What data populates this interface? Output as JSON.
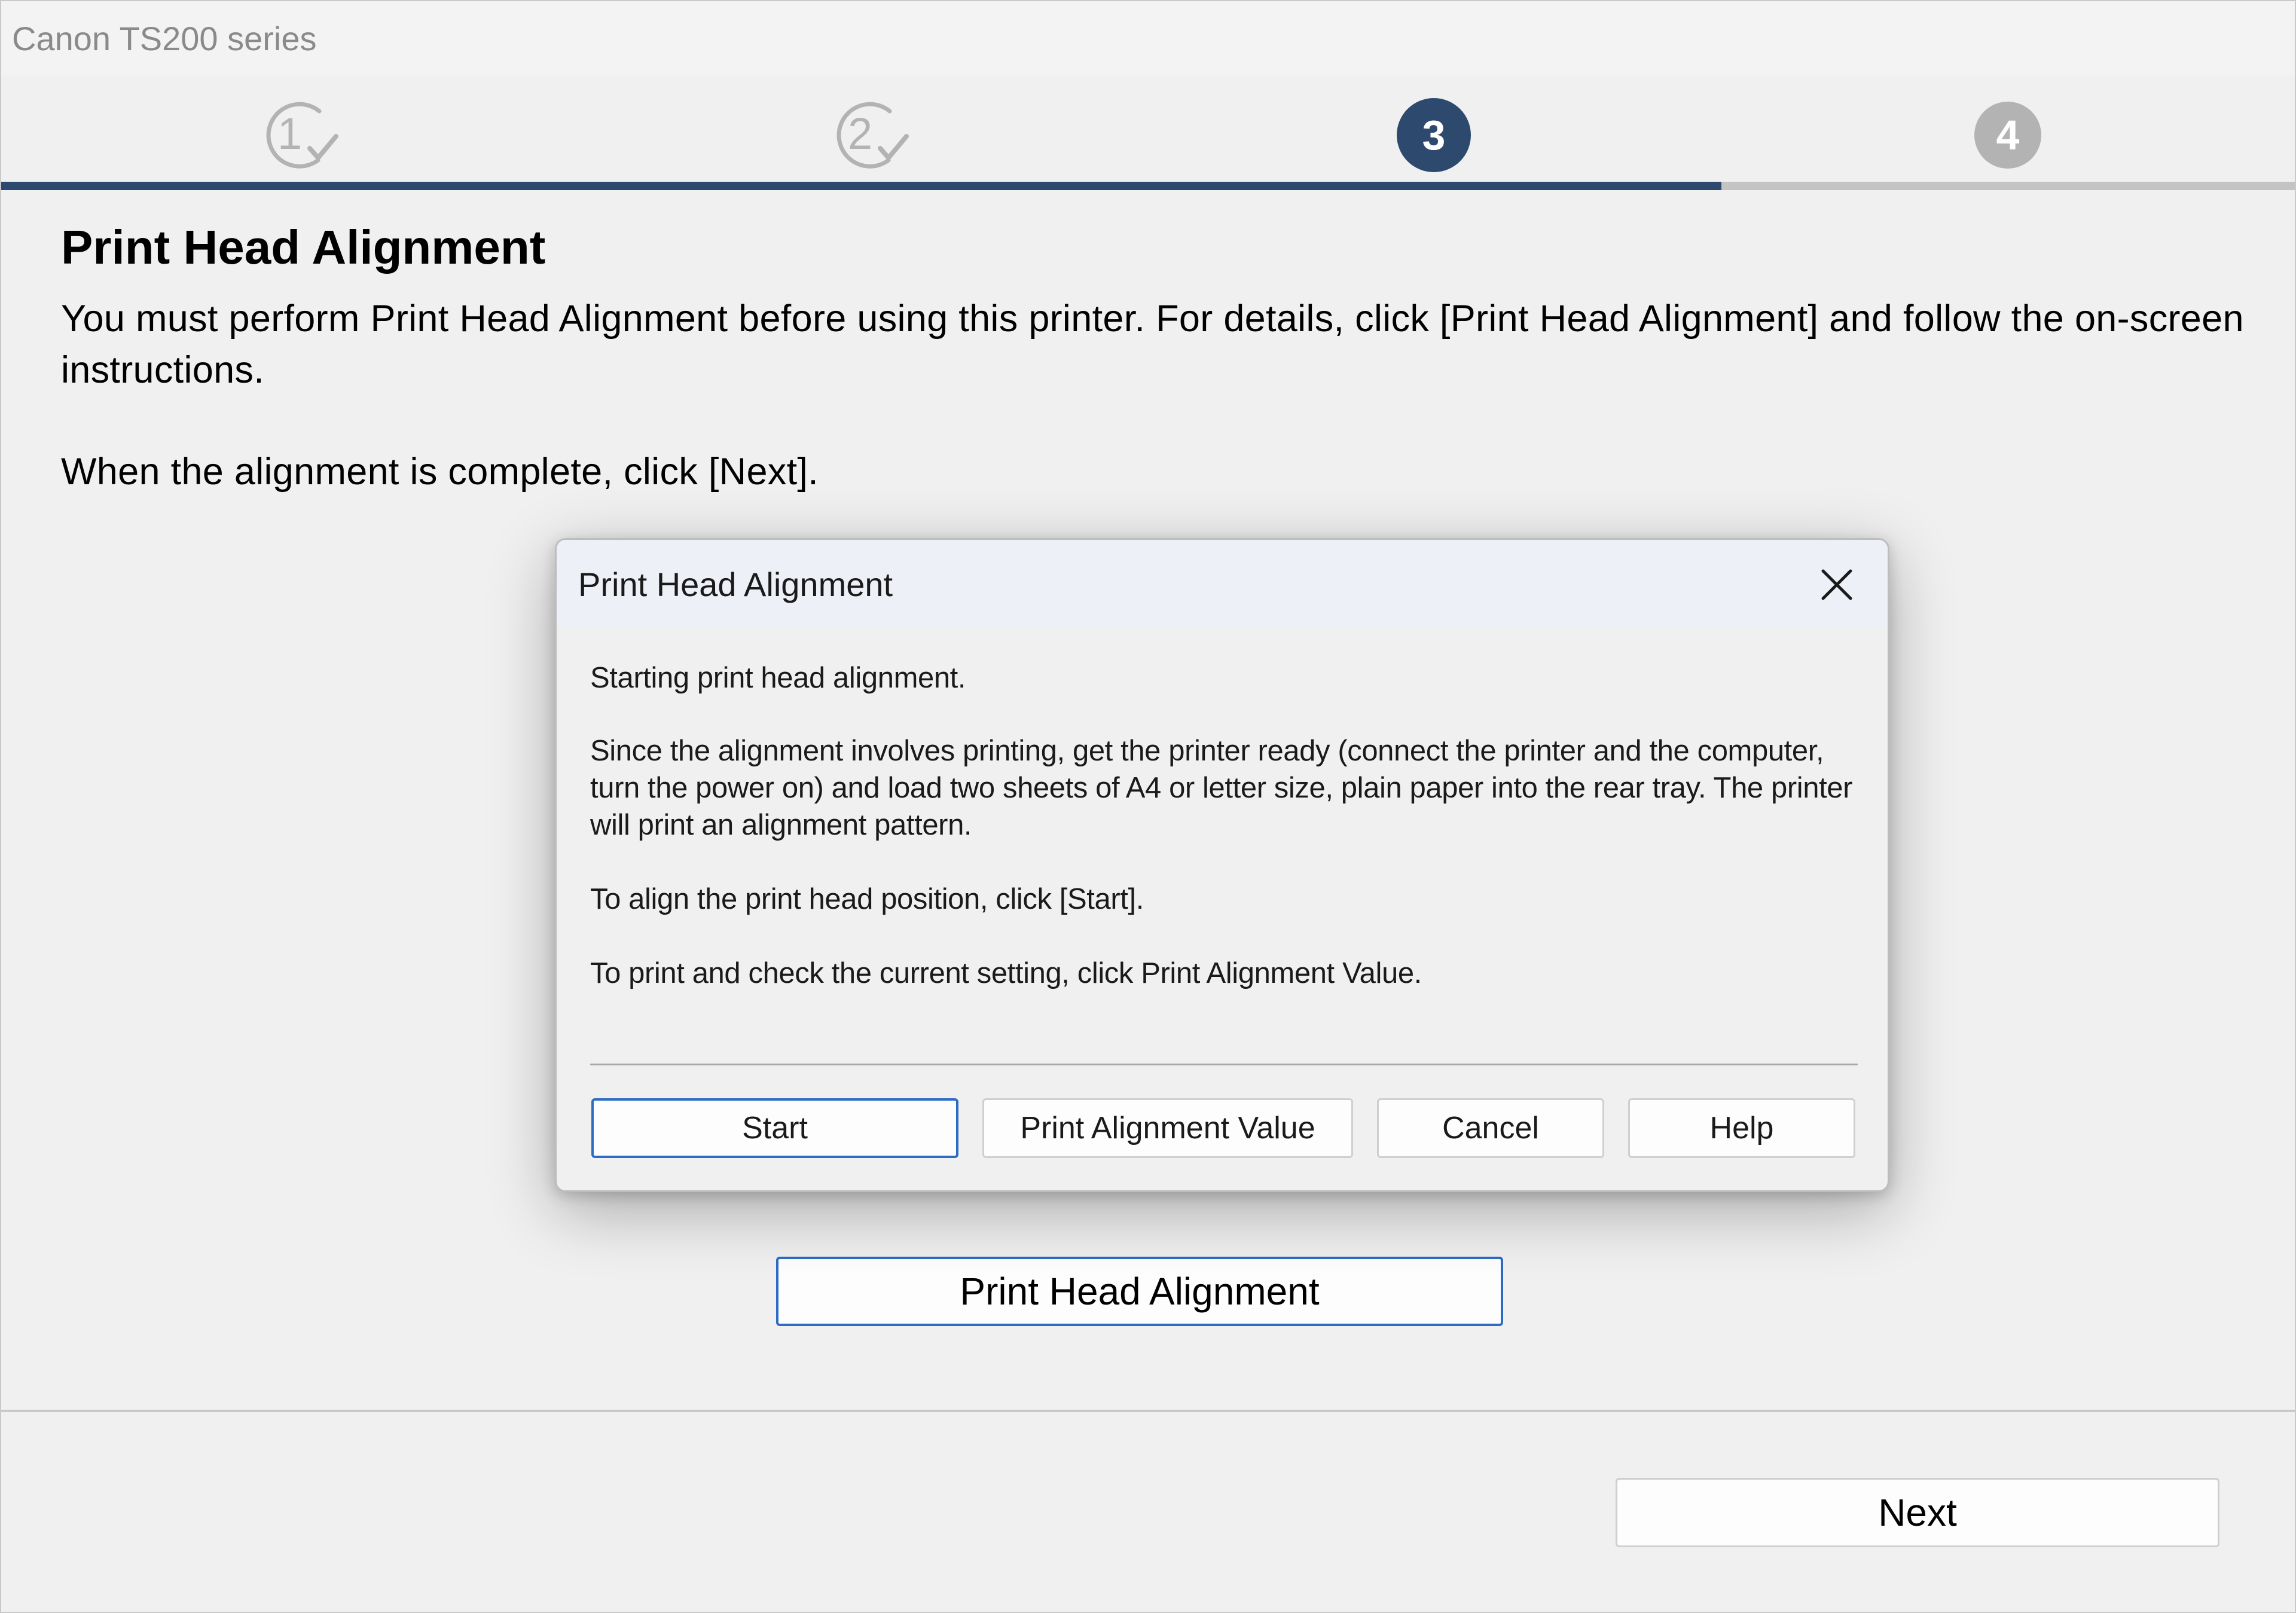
{
  "window": {
    "title": "Canon TS200 series"
  },
  "steps": [
    {
      "number": "1",
      "state": "completed"
    },
    {
      "number": "2",
      "state": "completed"
    },
    {
      "number": "3",
      "state": "current"
    },
    {
      "number": "4",
      "state": "upcoming"
    }
  ],
  "progress": {
    "completed_fraction": 0.75,
    "fill_color": "#2d4a6e",
    "track_color": "#c4c4c4"
  },
  "main": {
    "heading": "Print Head Alignment",
    "paragraph1": "You must perform Print Head Alignment before using this printer. For details, click [Print Head Alignment] and follow the on-screen instructions.",
    "paragraph2": "When the alignment is complete, click [Next].",
    "alignment_button_label": "Print Head Alignment"
  },
  "footer": {
    "next_label": "Next"
  },
  "dialog": {
    "title": "Print Head Alignment",
    "close_icon": "close-icon",
    "text1": "Starting print head alignment.",
    "text2": "Since the alignment involves printing, get the printer ready (connect the printer and the computer, turn the power on) and load two sheets of A4 or letter size, plain paper into the rear tray. The printer will print an alignment pattern.",
    "text3": "To align the print head position, click [Start].",
    "text4": "To print and check the current setting, click Print Alignment Value.",
    "buttons": {
      "start": "Start",
      "print_alignment_value": "Print Alignment Value",
      "cancel": "Cancel",
      "help": "Help"
    }
  },
  "colors": {
    "accent_blue": "#2d6cc6",
    "step_active": "#2d4a6e",
    "step_inactive": "#b3b3b3"
  }
}
